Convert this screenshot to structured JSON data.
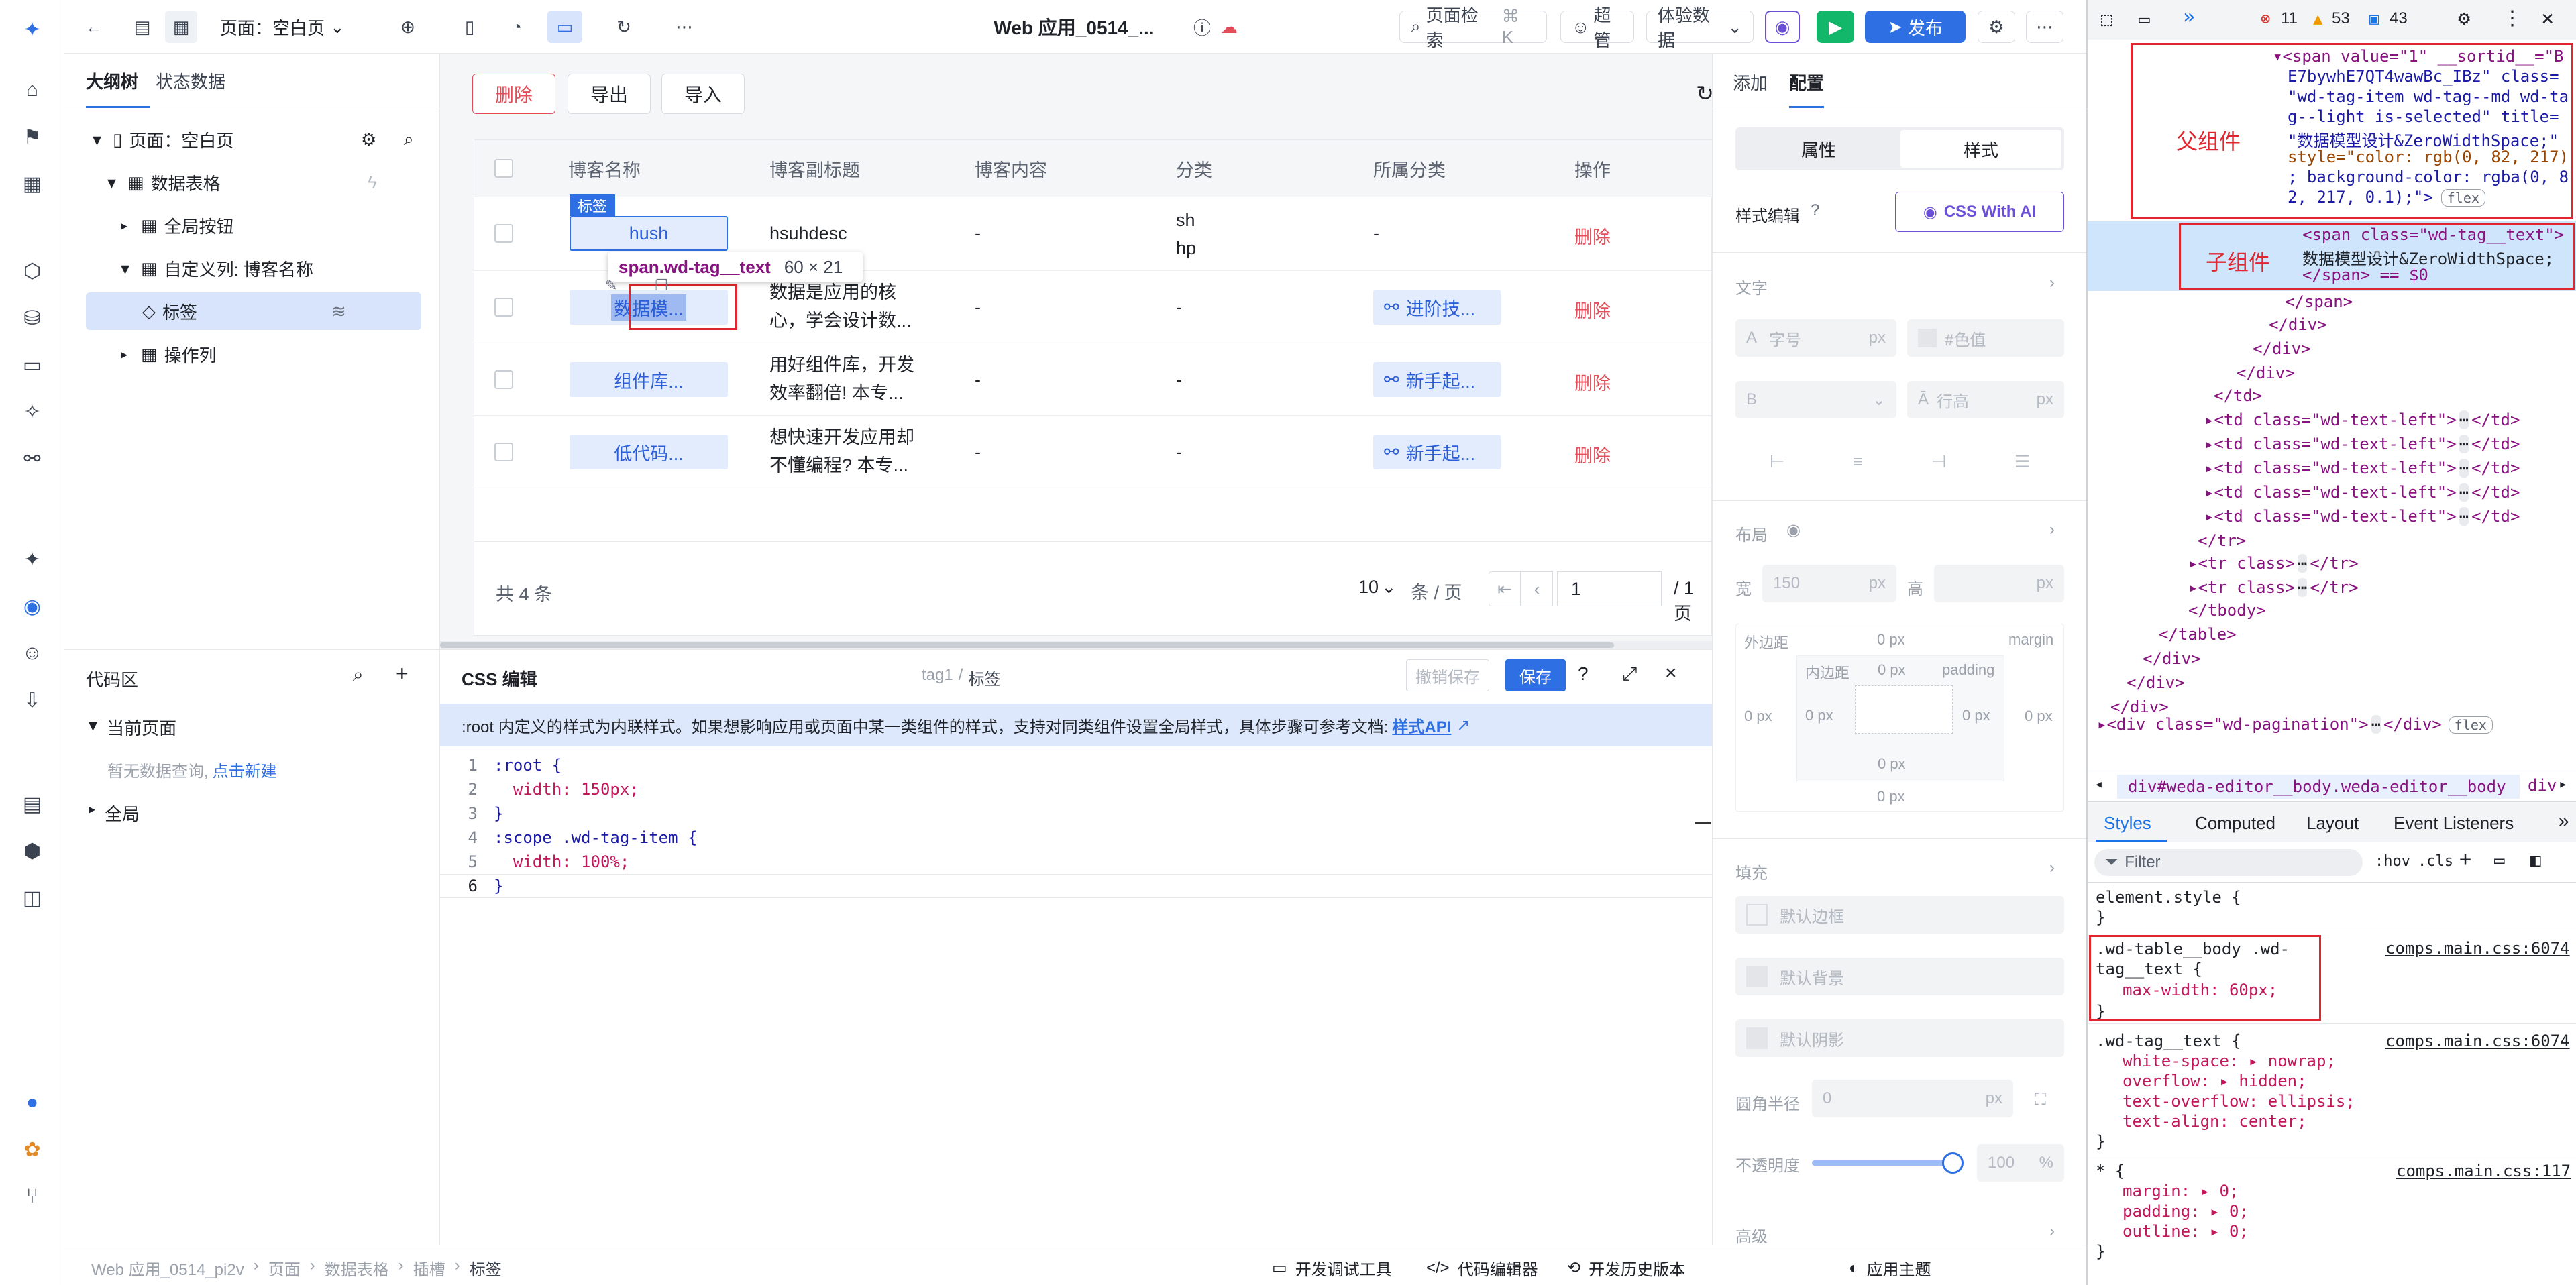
{
  "topbar": {
    "page_label": "页面：空白页",
    "app_title": "Web 应用_0514_...",
    "page_search": "页面检索",
    "shortcut": "⌘ K",
    "admin": "超管",
    "exp_data": "体验数据",
    "publish": "发布"
  },
  "left": {
    "tab_outline": "大纲树",
    "tab_state": "状态数据",
    "tree": [
      {
        "label": "页面：空白页"
      },
      {
        "label": "数据表格"
      },
      {
        "label": "全局按钮"
      },
      {
        "label": "自定义列: 博客名称"
      },
      {
        "label": "标签"
      },
      {
        "label": "操作列"
      }
    ],
    "code_title": "代码区",
    "code_current": "当前页面",
    "code_empty": "暂无数据查询,",
    "code_new": "点击新建",
    "code_global": "全局"
  },
  "toolbar": {
    "delete": "删除",
    "export": "导出",
    "import": "导入"
  },
  "table": {
    "headers": [
      "博客名称",
      "博客副标题",
      "博客内容",
      "分类",
      "所属分类",
      "操作"
    ],
    "rows": [
      {
        "name": "hush",
        "subtitle": "hsuhdesc",
        "content": "-",
        "cat1": "sh",
        "cat2": "hp",
        "belong": "-",
        "op": "删除"
      },
      {
        "name": "数据模...",
        "subtitle1": "数据是应用的核",
        "subtitle2": "心，学会设计数...",
        "content": "-",
        "cat": "-",
        "belong": "进阶技...",
        "op": "删除"
      },
      {
        "name": "组件库...",
        "subtitle1": "用好组件库，开发",
        "subtitle2": "效率翻倍! 本专...",
        "content": "-",
        "cat": "-",
        "belong": "新手起...",
        "op": "删除"
      },
      {
        "name": "低代码...",
        "subtitle1": "想快速开发应用却",
        "subtitle2": "不懂编程? 本专...",
        "content": "-",
        "cat": "-",
        "belong": "新手起...",
        "op": "删除"
      }
    ],
    "selected_badge": "标签",
    "tooltip_selector": "span.wd-tag__text",
    "tooltip_size": "60 × 21",
    "total": "共 4 条",
    "page_size": "10",
    "per_page": "条 / 页",
    "page": "1",
    "page_total": "/ 1 页"
  },
  "editor": {
    "title": "CSS 编辑",
    "crumb1": "tag1",
    "crumb_sep": "/",
    "crumb2": "标签",
    "undo": "撤销保存",
    "save": "保存",
    "notice": ":root 内定义的样式为内联样式。如果想影响应用或页面中某一类组件的样式，支持对同类组件设置全局样式，具体步骤可参考文档:",
    "notice_link": "样式API",
    "lines": [
      {
        "n": "1",
        "code": ":root {"
      },
      {
        "n": "2",
        "code": "  width: 150px;"
      },
      {
        "n": "3",
        "code": "}"
      },
      {
        "n": "4",
        "code": ":scope .wd-tag-item {"
      },
      {
        "n": "5",
        "code": "  width: 100%;"
      },
      {
        "n": "6",
        "code": "}"
      }
    ]
  },
  "right": {
    "tab_add": "添加",
    "tab_config": "配置",
    "seg_attr": "属性",
    "seg_style": "样式",
    "style_edit": "样式编辑",
    "css_ai": "CSS With AI",
    "text": "文字",
    "font_size": "字号",
    "px": "px",
    "color": "#色值",
    "line_height": "行高",
    "layout": "布局",
    "width_lbl": "宽",
    "width_val": "150",
    "height_lbl": "高",
    "margin_lbl": "外边距",
    "margin_word": "margin",
    "padding_lbl": "内边距",
    "padding_word": "padding",
    "zero_px": "0 px",
    "fill": "填充",
    "default_border": "默认边框",
    "default_bg": "默认背景",
    "default_shadow": "默认阴影",
    "radius": "圆角半径",
    "radius_val": "0",
    "opacity": "不透明度",
    "opacity_val": "100",
    "percent": "%",
    "advanced": "高级"
  },
  "status": {
    "breadcrumb": [
      "Web 应用_0514_pi2v",
      "页面",
      "数据表格",
      "插槽",
      "标签"
    ],
    "dev_tools": "开发调试工具",
    "code_editor": "代码编辑器",
    "history": "开发历史版本",
    "theme": "应用主题"
  },
  "devtools": {
    "errors": "11",
    "warnings": "53",
    "info": "43",
    "label_parent": "父组件",
    "label_child": "子组件",
    "dom_lines": [
      "▾<span value=\"1\" __sortid__=\"B",
      "E7bywhE7QT4wawBc_IBz\" class=",
      "\"wd-tag-item wd-tag--md wd-ta",
      "g--light is-selected\" title=",
      "\"数据模型设计&ZeroWidthSpace;\"",
      "style=\"color: rgb(0, 82, 217)",
      "; background-color: rgba(0, 8",
      "2, 217, 0.1);\">",
      "flex",
      "<span class=\"wd-tag__text\">",
      "数据模型设计&ZeroWidthSpace;",
      "</span> == $0",
      "</span>",
      "</div>",
      "</div>",
      "</div>",
      "</td>",
      "▸<td class=\"wd-text-left\">",
      "</td>",
      "</tr>",
      "▸<tr class>",
      "</tr>",
      "</tbody>",
      "</table>",
      "▸<div class=\"wd-pagination\">",
      "</div>",
      "div#weda-editor__body.weda-editor__body",
      "div"
    ],
    "tabs": [
      "Styles",
      "Computed",
      "Layout",
      "Event Listeners"
    ],
    "filter": "Filter",
    "hov": ":hov",
    "cls": ".cls",
    "element_style": "element.style {",
    "close_brace": "}",
    "rule1_sel": ".wd-table__body .wd-tag__text {",
    "rule1_src": "comps.main.css:6074",
    "rule1_prop": "max-width: 60px;",
    "rule2_sel": ".wd-tag__text {",
    "rule2_src": "comps.main.css:6074",
    "rule2_props": [
      "white-space: ▸ nowrap;",
      "overflow: ▸ hidden;",
      "text-overflow: ellipsis;",
      "text-align: center;"
    ],
    "rule3_sel": "* {",
    "rule3_src": "comps.main.css:117",
    "rule3_props": [
      "margin: ▸ 0;",
      "padding: ▸ 0;",
      "outline: ▸ 0;"
    ]
  }
}
